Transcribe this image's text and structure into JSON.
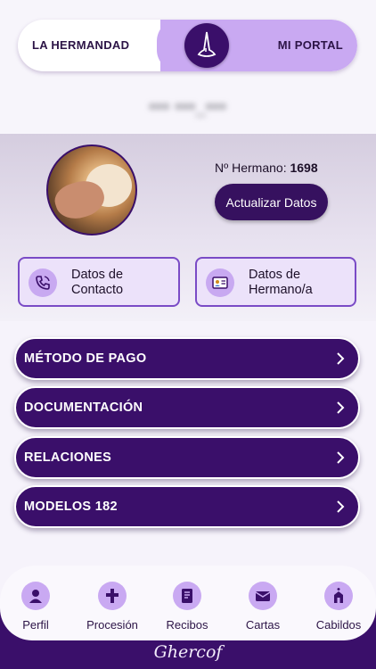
{
  "portal_toggle": {
    "left_label": "LA HERMANDAD",
    "right_label": "MI PORTAL",
    "knob_icon": "capirote-icon"
  },
  "profile": {
    "username_masked": "••• •••_•••",
    "member_prefix": "Nº Hermano:",
    "member_number": "1698",
    "update_button": "Actualizar Datos"
  },
  "cards": [
    {
      "line1": "Datos de",
      "line2": "Contacto",
      "icon": "phone-icon"
    },
    {
      "line1": "Datos de",
      "line2": "Hermano/a",
      "icon": "id-card-icon"
    }
  ],
  "menu": [
    {
      "label": "MÉTODO DE PAGO"
    },
    {
      "label": "DOCUMENTACIÓN"
    },
    {
      "label": "RELACIONES"
    },
    {
      "label": "MODELOS 182"
    }
  ],
  "tabs": [
    {
      "label": "Perfil",
      "icon": "user-icon"
    },
    {
      "label": "Procesión",
      "icon": "cross-icon"
    },
    {
      "label": "Recibos",
      "icon": "receipt-icon"
    },
    {
      "label": "Cartas",
      "icon": "mail-icon"
    },
    {
      "label": "Cabildos",
      "icon": "church-icon"
    }
  ],
  "brand": "Ghercof",
  "colors": {
    "primary": "#3a0f6a",
    "accent": "#c9a9f2",
    "card_bg": "#ece2fa"
  }
}
